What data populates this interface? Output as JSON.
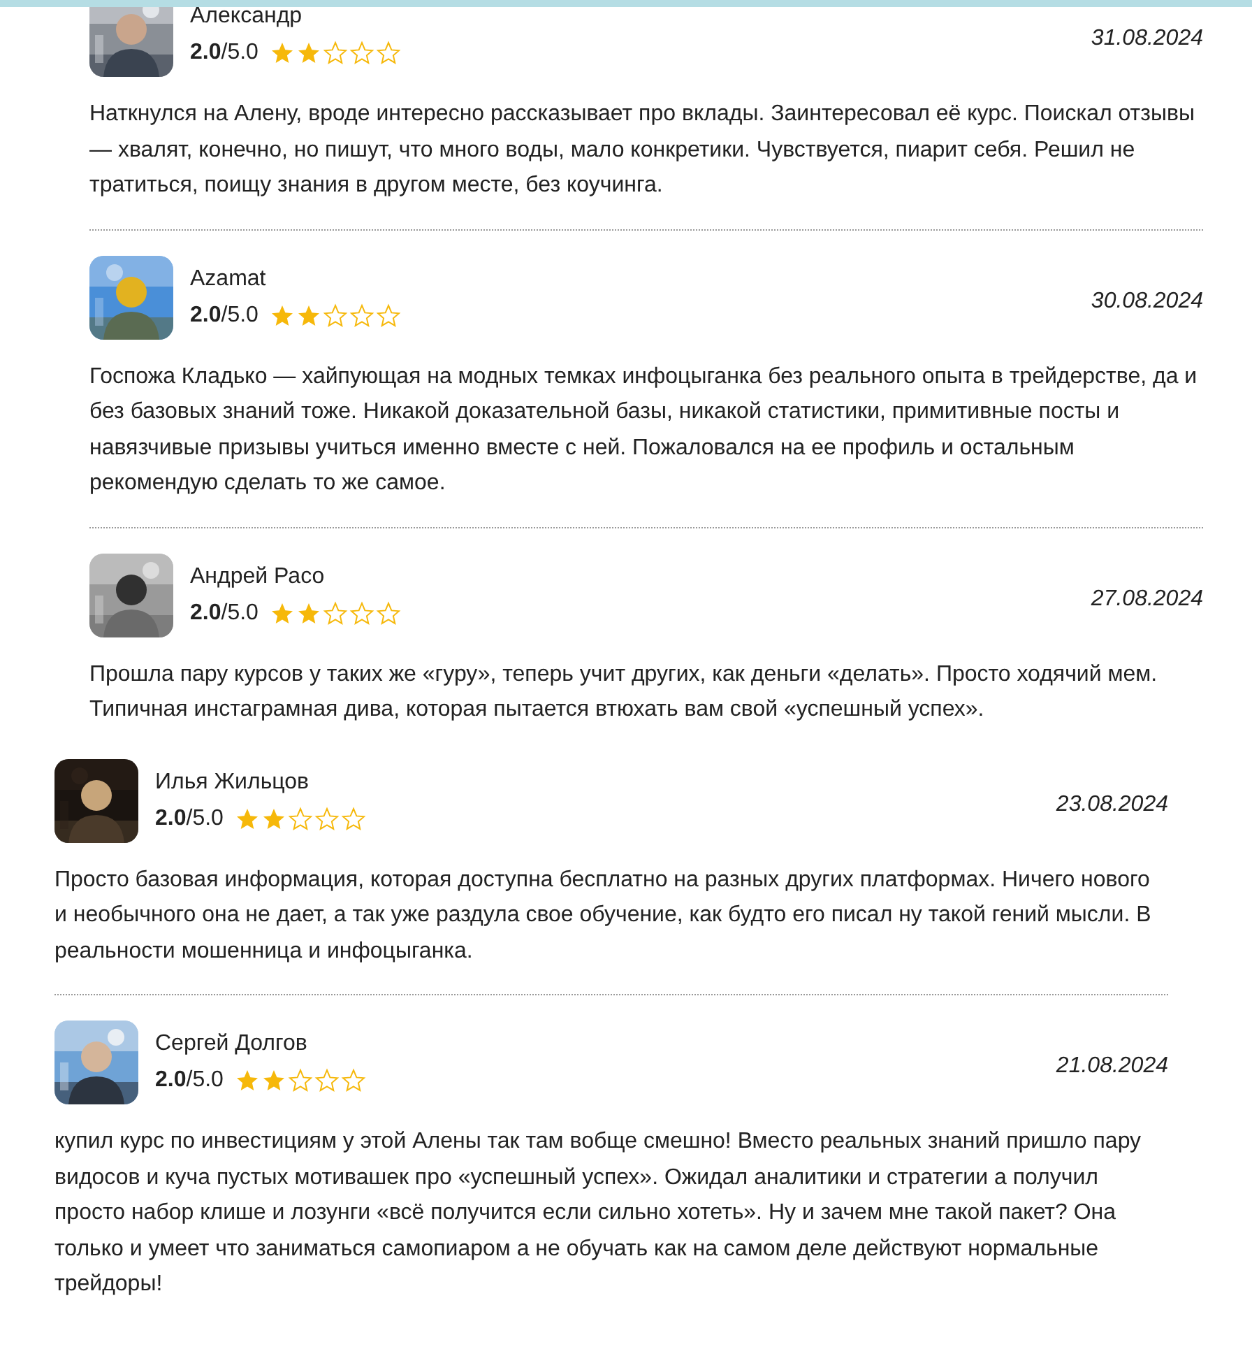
{
  "groups": [
    {
      "reviews": [
        {
          "author": "Александр",
          "rating": "**2.0**/5.0",
          "stars": 2,
          "date": "31.08.2024",
          "text": "Наткнулся на Алену, вроде интересно рассказывает про вклады. Заинтересовал её курс. Поискал отзывы — хвалят, конечно, но пишут, что много воды, мало конкретики. Чувствуется, пиарит себя. Решил не тратиться, поищу знания в другом месте, без коучинга."
        },
        {
          "author": "Azamat",
          "rating": "**2.0**/5.0",
          "stars": 2,
          "date": "30.08.2024",
          "text": "Госпожа Кладько — хайпующая на модных темках инфоцыганка без реального опыта в трейдерстве, да и без базовых знаний тоже. Никакой доказательной базы, никакой статистики, примитивные посты и навязчивые призывы учиться именно вместе с ней. Пожаловался на ее профиль и остальным рекомендую сделать то же самое."
        },
        {
          "author": "Андрей Расо",
          "rating": "**2.0**/5.0",
          "stars": 2,
          "date": "27.08.2024",
          "text": "Прошла пару курсов у таких же «гуру», теперь учит других, как деньги «делать». Просто ходячий мем. Типичная инстаграмная дива, которая пытается втюхать вам свой «успешный успех»."
        }
      ]
    },
    {
      "reviews": [
        {
          "author": "Илья Жильцов",
          "rating": "**2.0**/5.0",
          "stars": 2,
          "date": "23.08.2024",
          "text": "Просто базовая информация, которая доступна бесплатно на разных других платформах. Ничего нового и необычного она не дает, а так уже раздула свое обучение, как будто его писал ну такой гений мысли. В реальности мошенница и инфоцыганка."
        },
        {
          "author": "Сергей Долгов",
          "rating": "**2.0**/5.0",
          "stars": 2,
          "date": "21.08.2024",
          "text": "купил курс по инвестициям у этой Алены так там вобще смешно! Вместо реальных знаний пришло пару видосов и куча пустых мотивашек про «успешный успех». Ожидал аналитики и стратегии а получил просто набор клише и лозунги «всё получится если сильно хотеть». Ну и зачем мне такой пакет? Она только и умеет что заниматься самопиаром а не обучать как на самом деле действуют нормальные трейдоры!"
        }
      ]
    }
  ]
}
